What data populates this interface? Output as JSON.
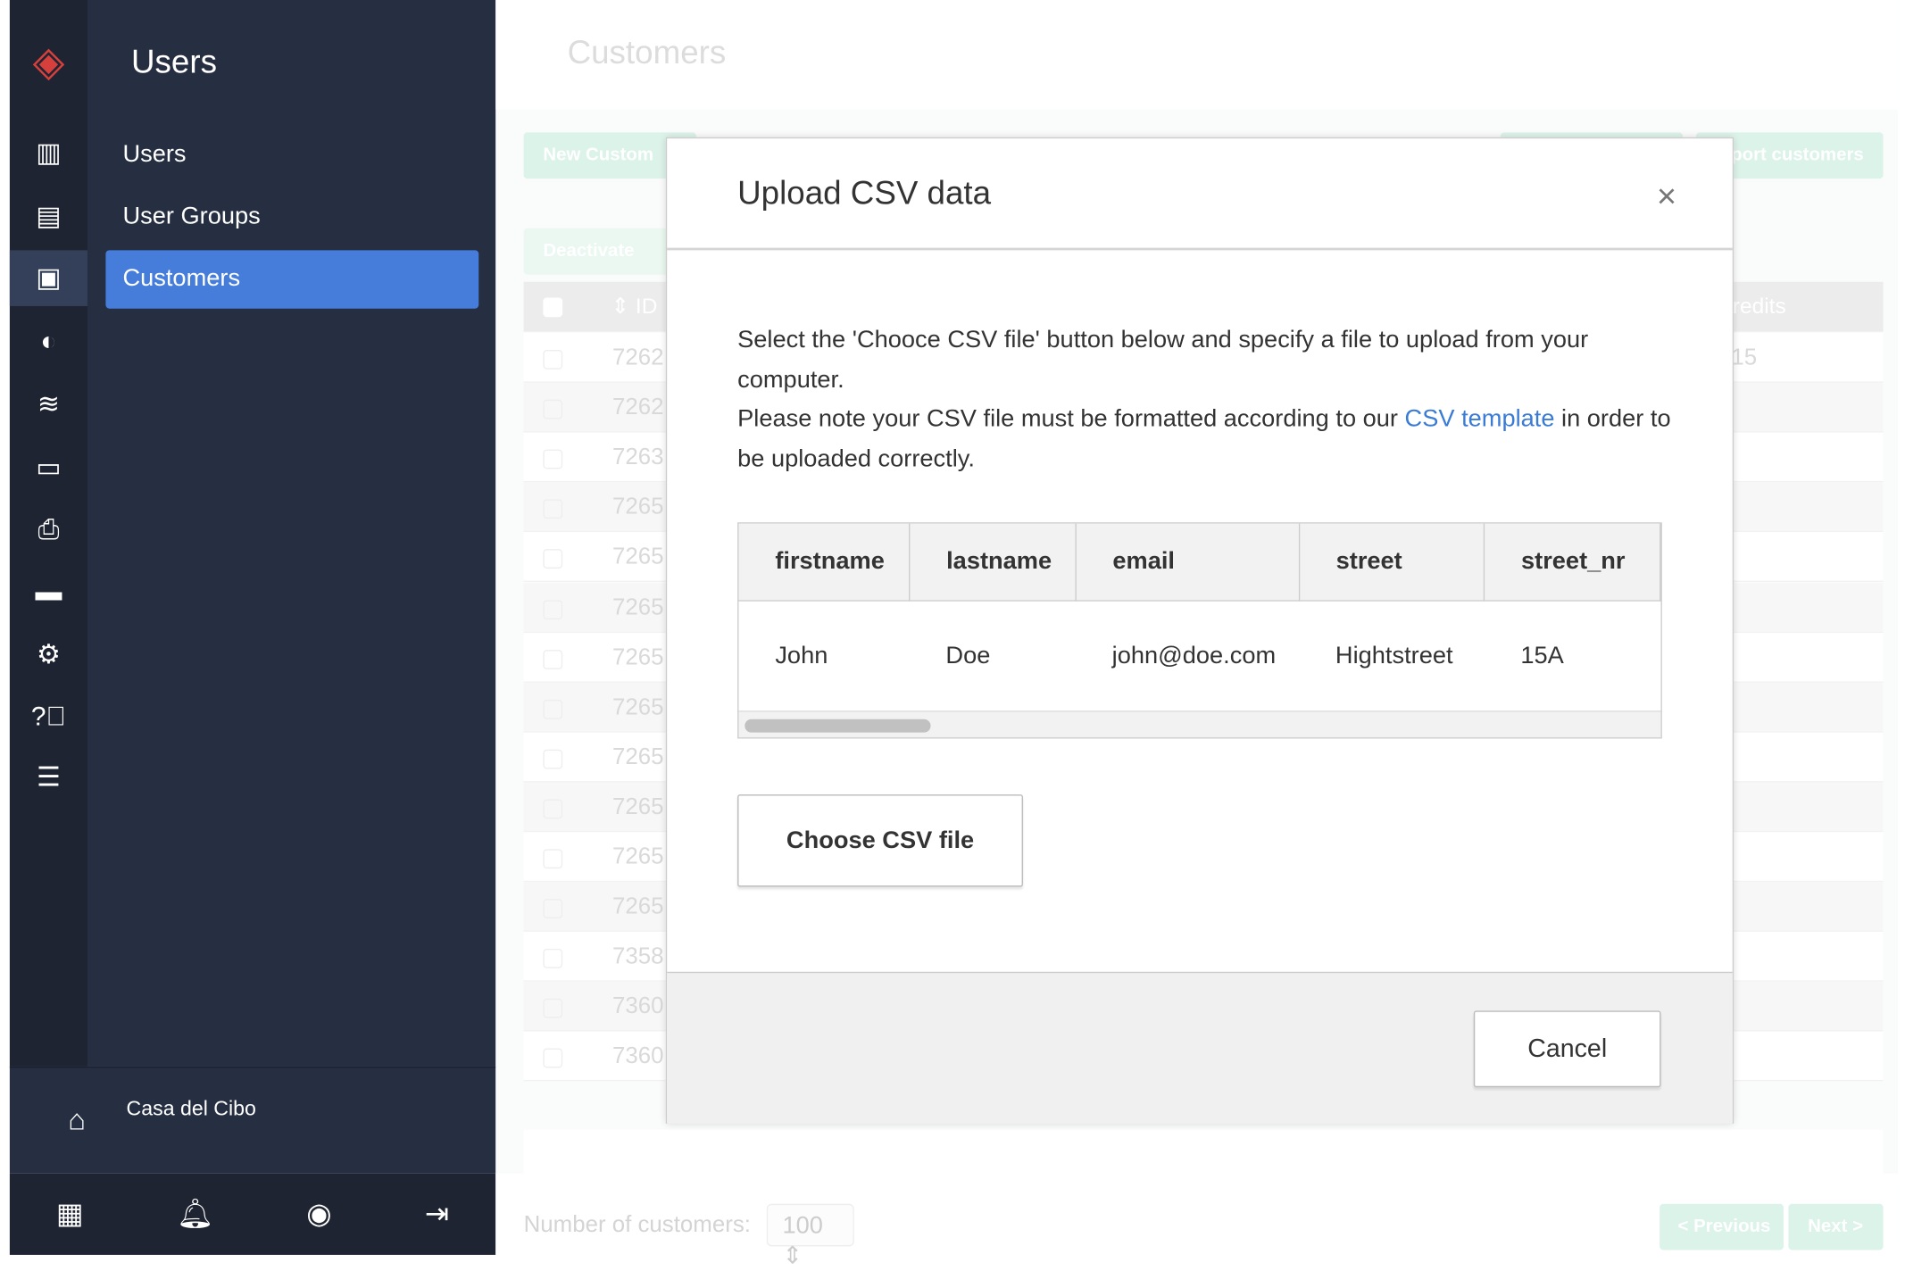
{
  "sidebar": {
    "title": "Users",
    "items": [
      {
        "label": "Users"
      },
      {
        "label": "User Groups"
      },
      {
        "label": "Customers"
      }
    ],
    "store": "Casa del Cibo",
    "icons": [
      "logo",
      "reports-icon",
      "clipboard-icon",
      "customer-card-icon",
      "wine-plate-icon",
      "layers-icon",
      "devices-icon",
      "printer-icon",
      "payment-cards-icon",
      "gear-icon",
      "help-icon",
      "server-icon"
    ],
    "brand_color": "#d6403c",
    "active_color": "#467ddb"
  },
  "background": {
    "page_title": "Customers",
    "new_customer": "New Custom",
    "import_customers": "port customers",
    "deactivate": "Deactivate",
    "col_id": "ID",
    "col_credits": "redits",
    "first_credit": "15",
    "ids": [
      "7262",
      "7262",
      "7263",
      "7265",
      "7265",
      "7265",
      "7265",
      "7265",
      "7265",
      "7265",
      "7265",
      "7265",
      "7358",
      "7360",
      "7360"
    ],
    "count_label": "Number of customers:",
    "count_value": "100",
    "prev": "< Previous",
    "next": "Next >"
  },
  "modal": {
    "title": "Upload CSV data",
    "close": "×",
    "line1": "Select the 'Chooce CSV file' button below and specify a file to upload from your computer.",
    "line2_pre": "Please note your CSV file must be formatted according to our ",
    "link": "CSV template",
    "line2_post": " in order to be uploaded correctly.",
    "table": {
      "headers": [
        "firstname",
        "lastname",
        "email",
        "street",
        "street_nr"
      ],
      "row": [
        "John",
        "Doe",
        "john@doe.com",
        "Hightstreet",
        "15A"
      ],
      "scroll_position": 0
    },
    "choose": "Choose CSV file",
    "cancel": "Cancel"
  }
}
